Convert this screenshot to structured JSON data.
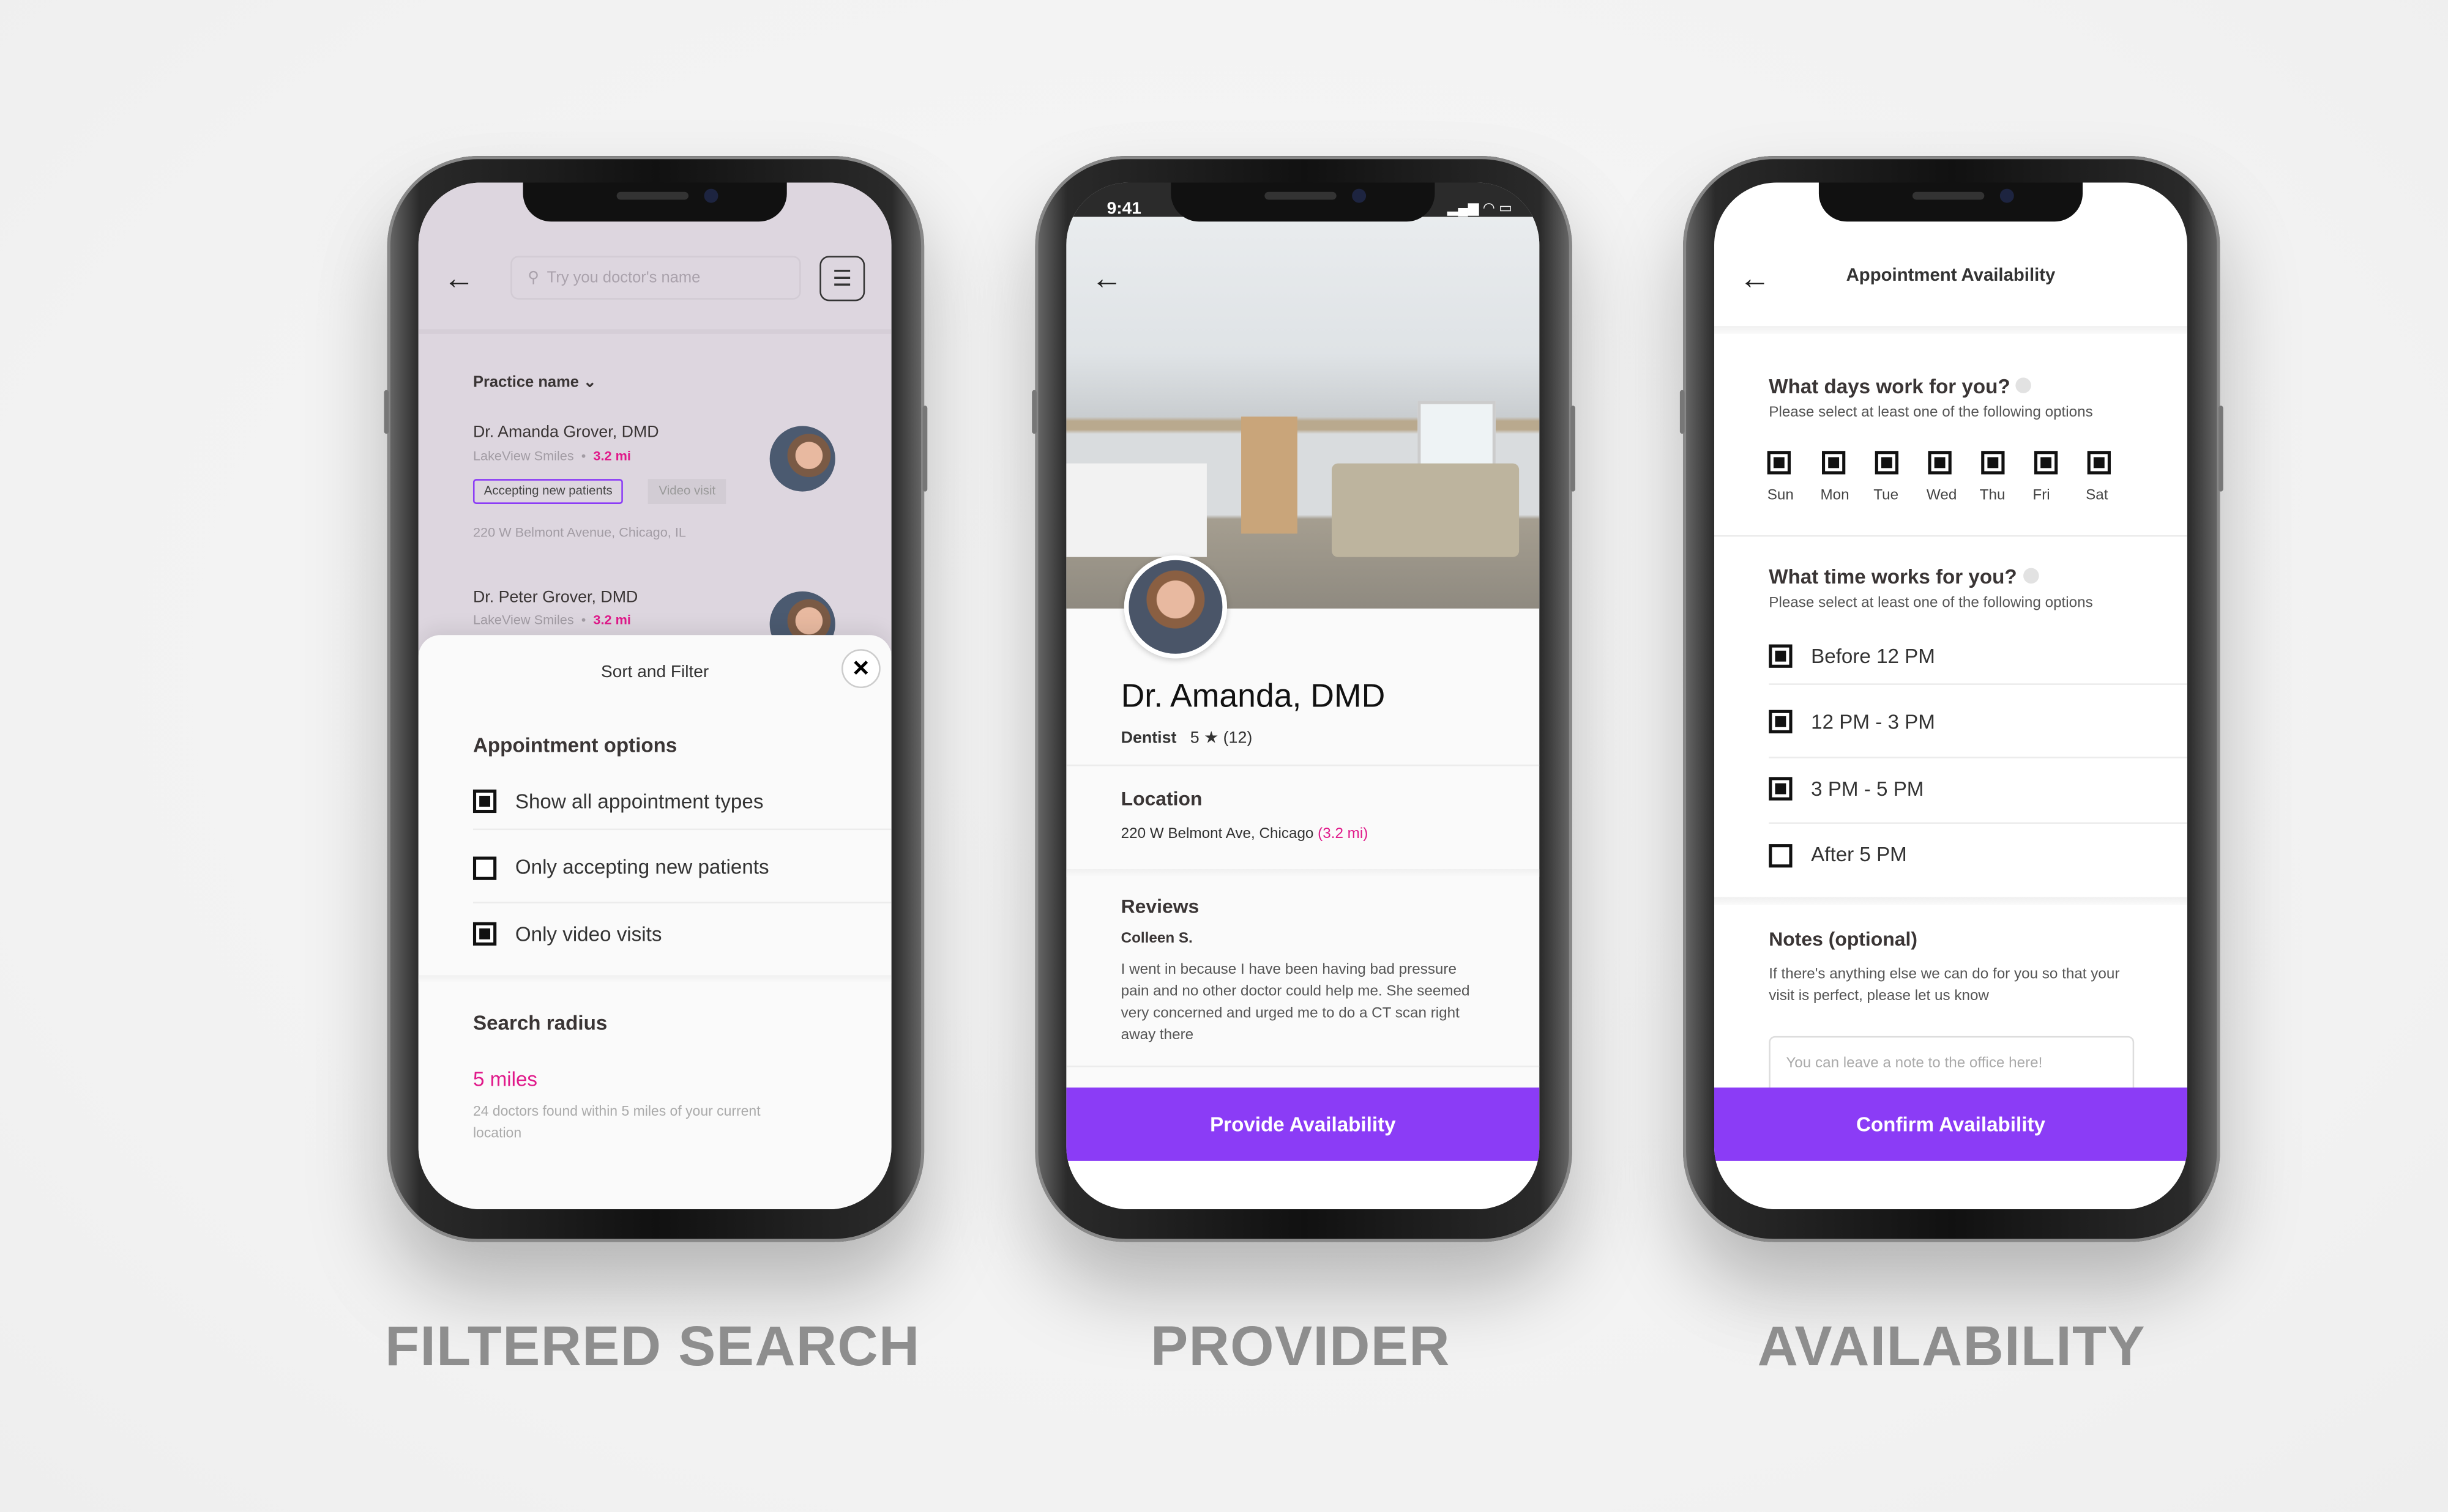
{
  "labels": {
    "filtered": "FILTERED SEARCH",
    "provider": "PROVIDER",
    "availability": "AVAILABILITY"
  },
  "colors": {
    "accent": "#8b3cf6",
    "distance": "#e0198a"
  },
  "search_screen": {
    "search_placeholder": "Try you doctor's name",
    "icons": {
      "back": "arrow-left-icon",
      "search": "search-icon",
      "filter": "sliders-icon",
      "close": "close-icon"
    },
    "sort_label": "Practice name",
    "doctors": [
      {
        "name": "Dr. Amanda Grover, DMD",
        "practice": "LakeView Smiles",
        "distance": "3.2 mi",
        "tags": [
          "Accepting new patients",
          "Video visit"
        ],
        "address": "220 W Belmont Avenue, Chicago, IL"
      },
      {
        "name": "Dr. Peter Grover, DMD",
        "practice": "LakeView Smiles",
        "distance": "3.2 mi"
      }
    ],
    "sheet": {
      "title": "Sort and Filter",
      "appointment_heading": "Appointment options",
      "options": [
        {
          "label": "Show all appointment types",
          "checked": true
        },
        {
          "label": "Only accepting new patients",
          "checked": false
        },
        {
          "label": "Only video visits",
          "checked": true
        }
      ],
      "radius_heading": "Search radius",
      "radius_value": "5 miles",
      "radius_desc": "24 doctors found within 5 miles of your current location"
    }
  },
  "provider_screen": {
    "time": "9:41",
    "name": "Dr. Amanda, DMD",
    "specialty": "Dentist",
    "rating": "5",
    "star": "★",
    "review_count": "(12)",
    "location_heading": "Location",
    "address": "220 W Belmont Ave, Chicago",
    "distance": "(3.2 mi)",
    "reviews_heading": "Reviews",
    "reviewer": "Colleen S.",
    "review_text": "I went in because I have been having bad pressure pain and no other doctor could help me. She seemed very concerned and urged me to do a CT scan right away there",
    "cta": "Provide Availability"
  },
  "availability_screen": {
    "title": "Appointment Availability",
    "days_heading": "What days work for you?",
    "days_sub": "Please select at least one of the following options",
    "days": [
      {
        "label": "Sun",
        "checked": true
      },
      {
        "label": "Mon",
        "checked": true
      },
      {
        "label": "Tue",
        "checked": true
      },
      {
        "label": "Wed",
        "checked": true
      },
      {
        "label": "Thu",
        "checked": true
      },
      {
        "label": "Fri",
        "checked": true
      },
      {
        "label": "Sat",
        "checked": true
      }
    ],
    "time_heading": "What time works for you?",
    "time_sub": "Please select at least one of the following options",
    "times": [
      {
        "label": "Before 12 PM",
        "checked": true
      },
      {
        "label": "12 PM - 3 PM",
        "checked": true
      },
      {
        "label": "3 PM - 5 PM",
        "checked": true
      },
      {
        "label": "After 5 PM",
        "checked": false
      }
    ],
    "notes_heading": "Notes (optional)",
    "notes_desc": "If there's anything else we can do for you so that your visit is perfect, please let us know",
    "notes_placeholder": "You can leave a note to the office here!",
    "cta": "Confirm Availability"
  }
}
